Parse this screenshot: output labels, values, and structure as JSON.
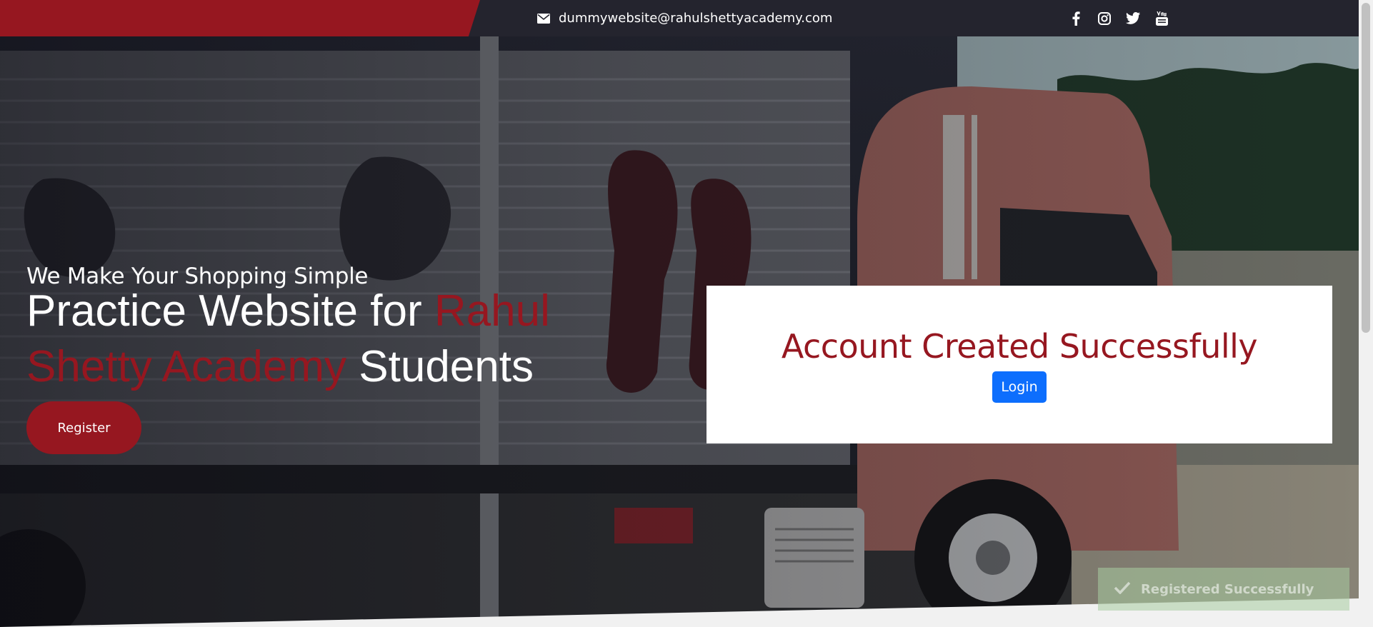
{
  "topbar": {
    "email": "dummywebsite@rahulshettyacademy.com",
    "mail_icon": "envelope-icon",
    "socials": [
      {
        "name": "facebook-icon",
        "label": "Facebook"
      },
      {
        "name": "instagram-icon",
        "label": "Instagram"
      },
      {
        "name": "twitter-icon",
        "label": "Twitter"
      },
      {
        "name": "youtube-icon",
        "label": "YouTube"
      }
    ]
  },
  "hero": {
    "tagline": "We Make Your Shopping Simple",
    "headline_prefix": "Practice Website for ",
    "headline_accent": "Rahul Shetty Academy",
    "headline_suffix": " Students",
    "register_label": "Register"
  },
  "modal": {
    "title": "Account Created Successfully",
    "login_label": "Login"
  },
  "toast": {
    "message": "Registered Successfully",
    "icon": "check-icon"
  },
  "colors": {
    "brand_red": "#961720",
    "topbar_dark": "#24242e",
    "login_blue": "#0d6efd",
    "toast_green": "#a8cca0"
  }
}
